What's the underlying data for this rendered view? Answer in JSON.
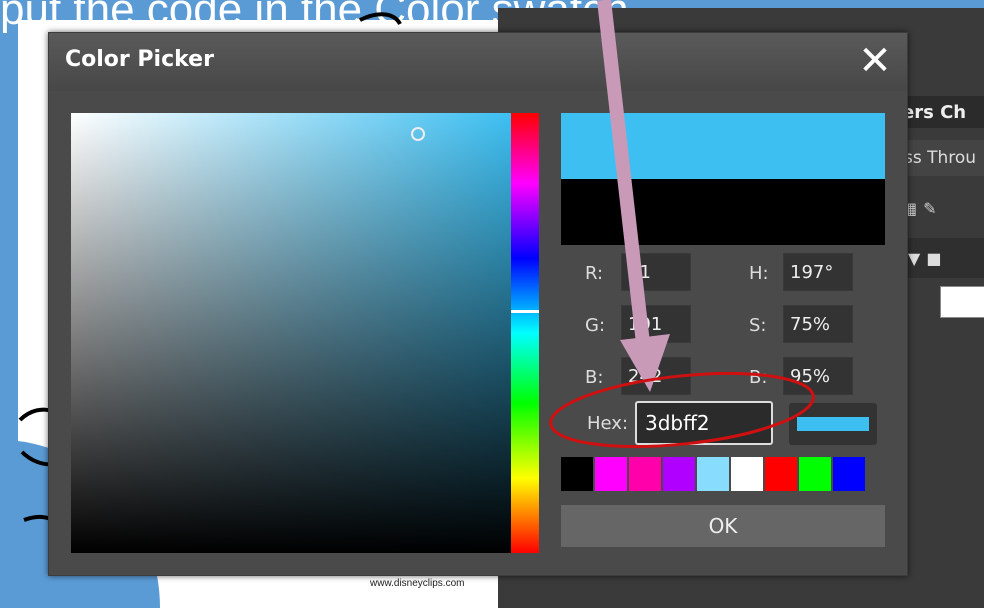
{
  "slide": {
    "title_fragment": "put the code in the Color swatch",
    "credit": "www.disneyclips.com"
  },
  "dialog": {
    "title": "Color Picker",
    "close_glyph": "✕",
    "fields": {
      "r_label": "R:",
      "r_value": "61",
      "g_label": "G:",
      "g_value": "191",
      "b_label": "B:",
      "b_value": "242",
      "h_label": "H:",
      "h_value": "197°",
      "s_label": "S:",
      "s_value": "75%",
      "bv_label": "B:",
      "bv_value": "95%"
    },
    "hex_label": "Hex:",
    "hex_value": "3dbff2",
    "ok_label": "OK",
    "swatches": [
      "#000000",
      "#ff00ff",
      "#ff00aa",
      "#b000ff",
      "#88ddff",
      "#ffffff",
      "#ff0000",
      "#00ff00",
      "#0000ff"
    ]
  },
  "panel": {
    "tabs": "ers  Ch",
    "blend": "ss Throu"
  },
  "colors": {
    "selected": "#3dbff2",
    "arrow": "#c89ab8",
    "circle": "#d01010"
  }
}
